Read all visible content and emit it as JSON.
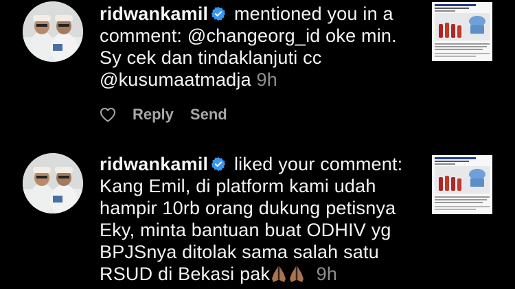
{
  "notifications": [
    {
      "username": "ridwankamil",
      "action": " mentioned you in a comment: @changeorg_id oke min. Sy cek dan  tindaklanjuti cc @kusumaatmadja ",
      "time": "9h",
      "actions": {
        "reply": "Reply",
        "send": "Send"
      }
    },
    {
      "username": "ridwankamil",
      "action": " liked your comment: Kang Emil, di platform kami udah hampir 10rb orang dukung petisnya Eky, minta bantuan buat ODHIV yg BPJSnya ditolak sama salah satu RSUD di Bekasi pak",
      "emoji": "🙏🏽🙏🏽",
      "time": "9h"
    }
  ],
  "icons": {
    "verified": "verified-badge-icon",
    "heart": "heart-outline-icon"
  },
  "colors": {
    "background": "#000000",
    "text": "#f5f5f5",
    "muted": "#8e8e8e",
    "verified": "#3897f0"
  }
}
